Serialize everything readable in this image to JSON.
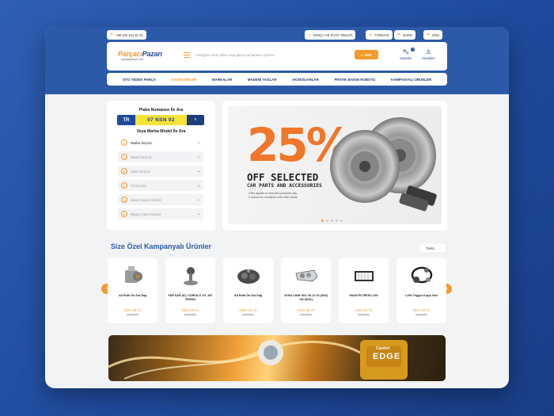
{
  "topbar": {
    "phone": "+90 242 511 51 51",
    "parts_price_offer": "PARÇA VE FİYAT TEKLİFİ",
    "country": "TÜRKİYE",
    "currency": "EURO",
    "language": "ENG"
  },
  "header": {
    "logo_part1": "Parçacı",
    "logo_part2": "Pazarı",
    "logo_sub": "parcacipazari.com",
    "search_placeholder": "Aradığınız ürün adını veya parça numarasını yazınız",
    "search_button": "ARA",
    "cart_label": "Sepetim",
    "cart_count": "0",
    "account_label": "Hesabım"
  },
  "nav": {
    "items": [
      "OTO YEDEK PARÇA",
      "KATEGORİLER",
      "MARKALAR",
      "MADENİ YAĞLAR",
      "AKSESUARLAR",
      "PRATİK BAKIM ROBOTU",
      "KAMPANYALI ÜRÜNLER"
    ],
    "active_index": 1
  },
  "plate_search": {
    "title": "Plaka Numarası İle Ara",
    "country_code": "TR",
    "plate_value": "07 NSN 92",
    "model_title": "Veya Marka Model İle Ara",
    "selects": [
      {
        "num": "1",
        "label": "Marka Seçiniz"
      },
      {
        "num": "2",
        "label": "Model Seçiniz"
      },
      {
        "num": "3",
        "label": "Kasa Seçiniz"
      },
      {
        "num": "4",
        "label": "Yıl Seçiniz"
      },
      {
        "num": "5",
        "label": "Motor Hacmi Seçiniz"
      },
      {
        "num": "6",
        "label": "Beygir Gücü Seçiniz"
      }
    ]
  },
  "promo": {
    "percent": "25%",
    "headline": "OFF SELECTED",
    "subline": "CAR PARTS AND ACCESSORIES",
    "note1": "Offer applies to selected products only.",
    "note2": "It cannot be combined with other deals."
  },
  "campaign": {
    "title": "Size Özel Kampanyalı Ürünler",
    "all_label": "Tümü",
    "products": [
      {
        "name": "Alt Rotil Ön Sol-Sağ",
        "price": "1037,29 TL",
        "old_price": "1049,99TL",
        "icon": "pump-part-icon"
      },
      {
        "name": "FAR SAĞ (E)- CORSA D -EL -MT XENON",
        "price": "1037,29 TL",
        "old_price": "1049,99TL",
        "icon": "ball-joint-icon"
      },
      {
        "name": "Alt Rotil Ön Sol-Sağ",
        "price": "1037,29 TL",
        "old_price": "1049,99TL",
        "icon": "water-pump-icon"
      },
      {
        "name": "AYNA CAMI SOL 09-12 X1 (E84) +IS-4HSL)",
        "price": "1037,29 TL",
        "old_price": "1049,99TL",
        "icon": "headlight-icon"
      },
      {
        "name": "HAVA FİLTRESİ L200",
        "price": "1037,29 TL",
        "old_price": "1049,99TL",
        "icon": "air-filter-icon"
      },
      {
        "name": "L200 Trigger Kayış Seti",
        "price": "1037,29 TL",
        "old_price": "1049,99TL",
        "icon": "belt-kit-icon"
      }
    ]
  },
  "oil_banner": {
    "brand": "Castrol",
    "product": "EDGE"
  },
  "colors": {
    "accent": "#f29a2e",
    "primary": "#2c5aa8",
    "navy": "#1f3f7a"
  }
}
